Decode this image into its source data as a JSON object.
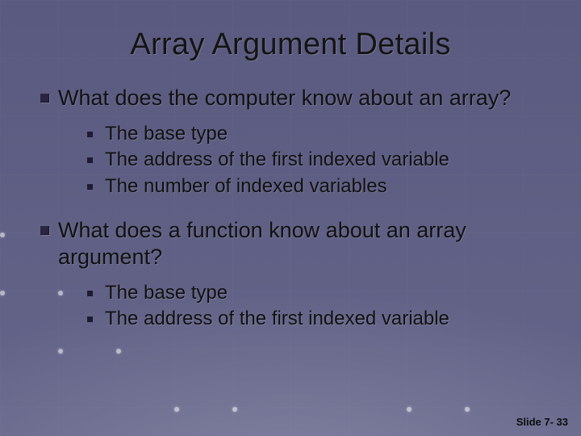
{
  "title": "Array Argument Details",
  "bullets": [
    {
      "text": "What does the computer know about an array?",
      "sub": [
        "The base type",
        "The address of the first indexed variable",
        "The number of indexed variables"
      ]
    },
    {
      "text": "What does a function know about an array argument?",
      "sub": [
        "The base type",
        "The address of the first indexed variable"
      ]
    }
  ],
  "footer": "Slide 7- 33"
}
